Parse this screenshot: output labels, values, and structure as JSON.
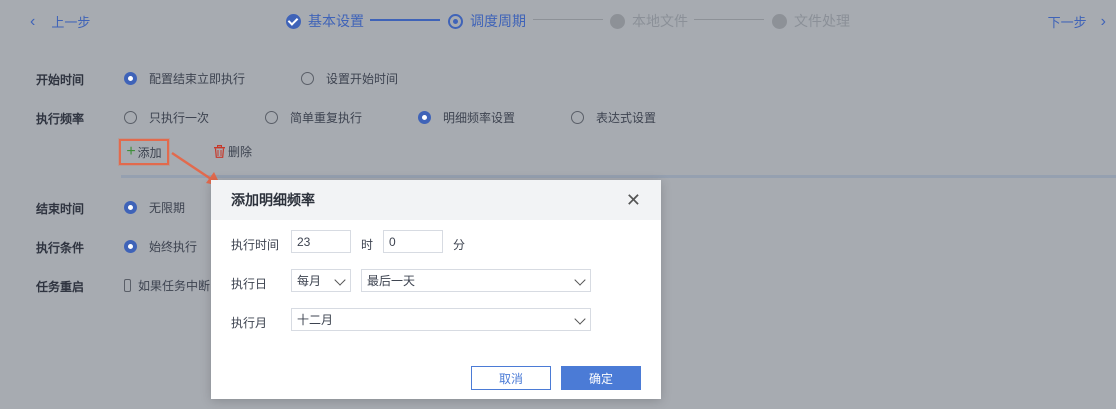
{
  "nav": {
    "prev_label": "上一步",
    "next_label": "下一步"
  },
  "steps": [
    {
      "label": "基本设置",
      "state": "done"
    },
    {
      "label": "调度周期",
      "state": "current"
    },
    {
      "label": "本地文件",
      "state": "todo"
    },
    {
      "label": "文件处理",
      "state": "todo"
    }
  ],
  "form": {
    "start_time": {
      "label": "开始时间",
      "options": [
        "配置结束立即执行",
        "设置开始时间"
      ],
      "selected": "配置结束立即执行"
    },
    "frequency": {
      "label": "执行频率",
      "options": [
        "只执行一次",
        "简单重复执行",
        "明细频率设置",
        "表达式设置"
      ],
      "selected": "明细频率设置"
    },
    "add_label": "添加",
    "delete_label": "删除",
    "end_time": {
      "label": "结束时间",
      "option": "无限期"
    },
    "condition": {
      "label": "执行条件",
      "option": "始终执行"
    },
    "restart": {
      "label": "任务重启",
      "checkbox_label": "如果任务中断"
    }
  },
  "dialog": {
    "title": "添加明细频率",
    "exec_time_label": "执行时间",
    "hour_value": "23",
    "hour_unit": "时",
    "minute_value": "0",
    "minute_unit": "分",
    "exec_day_label": "执行日",
    "day_period": "每月",
    "day_value": "最后一天",
    "exec_month_label": "执行月",
    "month_value": "十二月",
    "cancel_label": "取消",
    "ok_label": "确定"
  },
  "colors": {
    "accent": "#3f63b8",
    "primary_button": "#4b7bd6",
    "highlight": "#e26a4d",
    "overlay": "#a7abb1"
  }
}
